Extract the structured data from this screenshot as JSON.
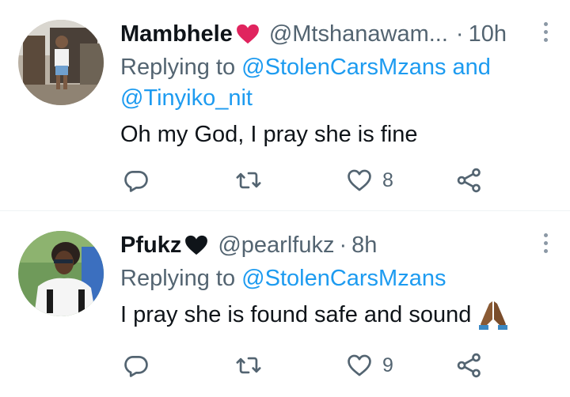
{
  "tweets": [
    {
      "display_name": "Mambhele",
      "badge_icon": "pink-heart-icon",
      "handle": "@Mtshanawam...",
      "separator": "·",
      "time": "10h",
      "replying_prefix": "Replying to",
      "replying_user_1": "@StolenCarsMzans",
      "replying_and": "and",
      "replying_user_2": "@Tinyiko_nit",
      "text": "Oh my God, I pray she is fine",
      "like_count": "8",
      "accent_color": "#e0245e"
    },
    {
      "display_name": "Pfukz",
      "badge_icon": "black-heart-icon",
      "handle": "@pearlfukz",
      "separator": "·",
      "time": "8h",
      "replying_prefix": "Replying to",
      "replying_user_1": "@StolenCarsMzans",
      "text": "I pray she is found safe and sound",
      "emoji": "folded-hands-icon",
      "like_count": "9"
    }
  ],
  "colors": {
    "link": "#1d9bf0",
    "secondary": "#536471",
    "primary": "#0f1419"
  }
}
